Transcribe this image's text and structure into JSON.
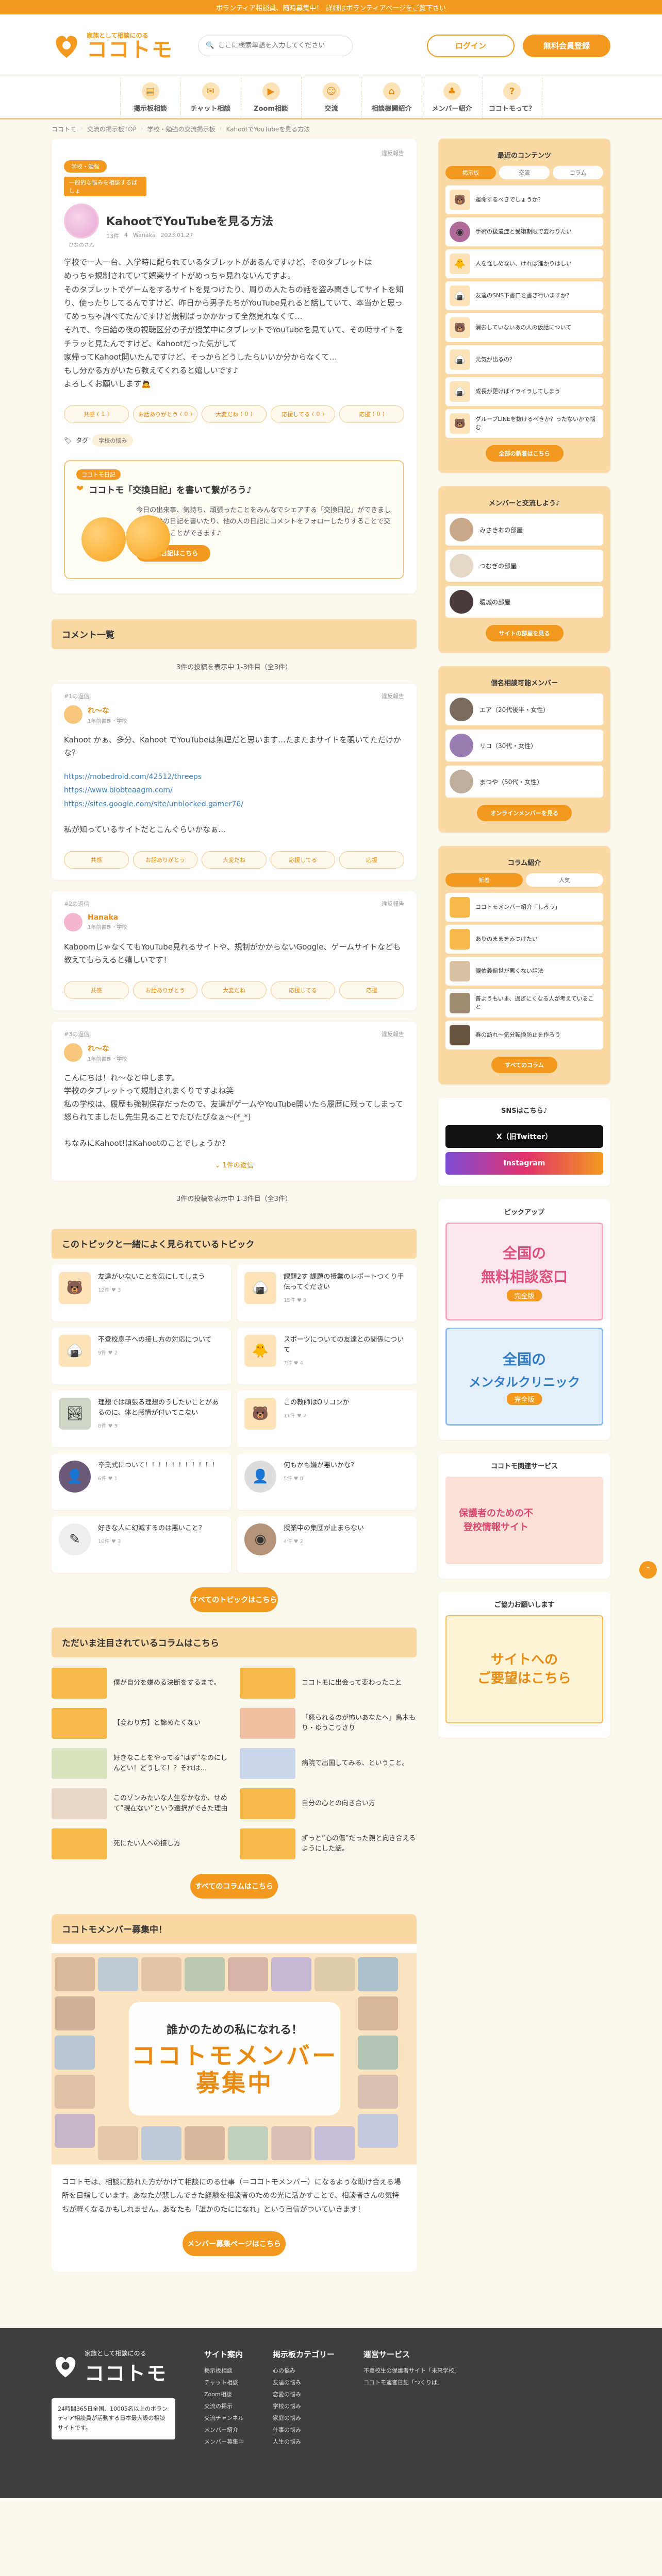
{
  "topbar": {
    "text": "ボランティア相談員、随時募集中！",
    "link": "詳細はボランティアページをご覧下さい"
  },
  "header": {
    "logo_tag": "家族として相談にのる",
    "logo_name": "ココトモ",
    "search_placeholder": "ここに検索単語を入力してください",
    "login": "ログイン",
    "register": "無料会員登録"
  },
  "gnav": [
    {
      "label": "掲示板相談",
      "icon": "board-icon"
    },
    {
      "label": "チャット相談",
      "icon": "chat-icon"
    },
    {
      "label": "Zoom相談",
      "icon": "video-icon"
    },
    {
      "label": "交流",
      "icon": "people-icon"
    },
    {
      "label": "相談機関紹介",
      "icon": "building-icon"
    },
    {
      "label": "メンバー紹介",
      "icon": "member-icon"
    },
    {
      "label": "ココトモって？",
      "icon": "info-icon"
    }
  ],
  "breadcrumb": [
    "ココトモ",
    "交流の掲示板TOP",
    "学校・勉強の交流掲示板",
    "KahootでYouTubeを見る方法"
  ],
  "post": {
    "report": "違反報告",
    "category": "学校・勉強",
    "subcategory": "一般的な悩みを相談するばしょ",
    "title": "KahootでYouTubeを見る方法",
    "meta_posts": "13件",
    "meta_likes": "4",
    "meta_author": "Wanaka",
    "date": "2023.01.27",
    "author_name": "ひなのさん",
    "body": "学校で一人一台、入学時に配られているタブレットがあるんですけど、そのタブレットは\nめっちゃ規制されていて娯楽サイトがめっちゃ見れないんですよ。\nそのタブレットでゲームをするサイトを見つけたり、周りの人たちの話を盗み聞きしてサイトを知り、使ったりしてるんですけど、昨日から男子たちがYouTube見れると話していて、本当かと思ってめっちゃ調べてたんですけど規制ばっかかかって全然見れなくて…\nそれで、今日給の夜の視聴区分の子が授業中にタブレットでYouTubeを見ていて、その時サイトをチラッと見たんですけど、Kahootだった気がして\n家帰ってKahoot開いたんですけど、そっからどうしたらいいか分からなくて…\nもし分かる方がいたら教えてくれると嬉しいです♪\nよろしくお願いします🙇",
    "reactions": [
      {
        "label": "共感",
        "count": "1"
      },
      {
        "label": "お話ありがとう",
        "count": "0"
      },
      {
        "label": "大変だね",
        "count": "0"
      },
      {
        "label": "応援してる",
        "count": "0"
      },
      {
        "label": "応援",
        "count": "0"
      }
    ],
    "tags_label": "タグ",
    "tag": "学校の悩み"
  },
  "diary": {
    "label": "ココトモ日記",
    "title": "ココトモ「交換日記」を書いて繋がろう♪",
    "text": "今日の出来事、気持ち、頑張ったことをみんなでシェアする「交換日記」ができました。自分の日記を書いたり、他の人の日記にコメントをフォローしたりすることで交流を深めることができます♪",
    "button": "交換日記はこちら"
  },
  "comments_section": {
    "title": "コメント一覧",
    "pager": "3件の投稿を表示中 1-3件目（全3件）",
    "items": [
      {
        "no": "#1の返信",
        "report": "違反報告",
        "name": "れ～な",
        "sub": "1年前書き・学校",
        "text": "Kahoot かぁ、多分、Kahoot でYouTubeは無理だと思います…たまたまサイトを覗いてただけかな？",
        "links": [
          "https://mobedroid.com/42512/threeps",
          "https://www.blobteaagm.com/",
          "https://sites.google.com/site/unblocked.gamer76/"
        ],
        "after": "私が知っているサイトだとこんぐらいかなぁ…",
        "reactions": [
          "共感",
          "お話ありがとう",
          "大変だね",
          "応援してる",
          "応援"
        ]
      },
      {
        "no": "#2の返信",
        "report": "違反報告",
        "name": "Hanaka",
        "sub": "1年前書き・学校",
        "text": "KaboomじゃなくてもYouTube見れるサイトや、規制がかからないGoogle、ゲームサイトなども教えてもらえると嬉しいです！",
        "links": [],
        "after": "",
        "reactions": [
          "共感",
          "お話ありがとう",
          "大変だね",
          "応援してる",
          "応援"
        ]
      },
      {
        "no": "#3の返信",
        "report": "違反報告",
        "name": "れ～な",
        "sub": "1年前書き・学校",
        "text": "こんにちは！れ～なと申します。\n学校のタブレットって規制されまくりですよね笑\n私の学校は、履歴も強制保存だったので、友達がゲームやYouTube開いたら履歴に残ってしまって怒られてましたし先生見ることでたびたびなぁ〜(*_*)\n\nちなみにKahoot!はKahootのことでしょうか？",
        "links": [],
        "after": "",
        "reactions": []
      }
    ],
    "more": "1件の返信"
  },
  "topics_section": {
    "title": "このトピックと一緒によく見られているトピック",
    "items": [
      {
        "title": "友達がいないことを気にしてしまう",
        "meta": "12件 ♥ 3"
      },
      {
        "title": "課題2す 課題の授業のレポートつくり手伝ってください",
        "meta": "15件 ♥ 9"
      },
      {
        "title": "不登校息子への接し方の対応について",
        "meta": "9件 ♥ 2"
      },
      {
        "title": "スポーツについての友達との関係について",
        "meta": "7件 ♥ 4"
      },
      {
        "title": "理想では頑張る理想のうしたいことがあるのに、体と感情が付いてこない",
        "meta": "8件 ♥ 5"
      },
      {
        "title": "この教師はOリコンか",
        "meta": "11件 ♥ 2"
      },
      {
        "title": "卒業式について！！！！！！！！！！！",
        "meta": "6件 ♥ 1"
      },
      {
        "title": "何もかも嫌が悪いかな？",
        "meta": "5件 ♥ 0"
      },
      {
        "title": "好きな人に幻滅するのは悪いこと？",
        "meta": "10件 ♥ 3"
      },
      {
        "title": "授業中の集団が止まらない",
        "meta": "4件 ♥ 2"
      }
    ],
    "button": "すべてのトピックはこちら"
  },
  "columns_section": {
    "title": "ただいま注目されているコラムはこちら",
    "items": [
      {
        "title": "僕が自分を嫌める決断をするまで。"
      },
      {
        "title": "ココトモに出会って変わったこと"
      },
      {
        "title": "【変わり方】と諦めたくない"
      },
      {
        "title": "「怒られるのが怖いあなたへ」鳥木もり・ゆうこりさり"
      },
      {
        "title": "好きなことをやってる”はず”なのにしんどい！どうして！？それは…"
      },
      {
        "title": "病院で出国してみる、ということ。"
      },
      {
        "title": "このゾンみたいな人生なかなか、せめて”現在ない”という選択ができた理由"
      },
      {
        "title": "自分の心との向き合い方"
      },
      {
        "title": "死にたい人への接し方"
      },
      {
        "title": "ずっと”心の傷”だった親と向き合えるようにした話。"
      }
    ],
    "button": "すべてのコラムはこちら"
  },
  "recruit": {
    "title": "ココトモメンバー募集中！",
    "banner_sub": "誰かのための私になれる！",
    "banner_main": "ココトモメンバー\n募集中",
    "text": "ココトモは、相談に訪れた方がかけて相談にのる仕事（＝ココトモメンバー）になるような助け合える場所を目指しています。あなたが悲しんできた経験を相談者のための光に活かすことで、相談者さんの気持ちが軽くなるかもしれません。あなたも「誰かのたにになれ」という自信がついていきます！",
    "button": "メンバー募集ページはこちら"
  },
  "sidebar": {
    "latest": {
      "title": "最近のコンテンツ",
      "tabs": [
        "掲示板",
        "交流",
        "コラム"
      ],
      "items": [
        "運命するべきでしょうか？",
        "手術の後遺症と受術期限で変わりたい",
        "人を怪しめない、ければ進かりはしい",
        "友達のSNS下書口を書き行いますか？",
        "消去していないあの人の仮話について",
        "元気が出るの？",
        "成長が更けばイライラしてしまう",
        "グループLINEを抜けるべきか？ったないかで悩む"
      ],
      "button": "全部の新着はこちら"
    },
    "members": {
      "title": "メンバーと交流しよう♪",
      "items": [
        "みさきおの部屋",
        "つむぎの部屋",
        "暖城の部屋"
      ],
      "button": "サイトの部屋を見る"
    },
    "online": {
      "title": "個名相談可能メンバー",
      "items": [
        "エア（20代後半・女性）",
        "リコ（30代・女性）",
        "まつや（50代・女性）"
      ],
      "button": "オンラインメンバーを見る"
    },
    "column": {
      "title": "コラム紹介",
      "tabs": [
        "新着",
        "人気"
      ],
      "items": [
        "ココトモメンバー紹介「しろう」",
        "ありのままをみつけたい",
        "親依義偏世が悪くない話法",
        "普ようもいま、過ぎにくなる人が考えていること",
        "春の訪れ〜気分転換防止を作ろう"
      ],
      "button": "すべてのコラム"
    },
    "sns": {
      "title": "SNSはこちら♪",
      "x": "X（旧Twitter）",
      "instagram": "Instagram"
    },
    "pickup": {
      "title": "ピックアップ",
      "b1a": "全国の",
      "b1b": "無料相談窓口",
      "b1c": "完全版",
      "b2a": "全国の",
      "b2b": "メンタルクリニック",
      "b2c": "完全版"
    },
    "service": {
      "title": "ココトモ関連サービス",
      "banner": "保護者のための不登校情報サイト"
    },
    "request": {
      "title": "ご協力お願いします",
      "banner": "サイトへの\nご要望はこちら"
    }
  },
  "footer": {
    "logo_tag": "家族として相談にのる",
    "logo_name": "ココトモ",
    "desc": "24時間365日全国、10005名以上のボランティア相談員が活動する日本最大級の相談サイトです。",
    "site_title": "サイト案内",
    "site": [
      "掲示板相談",
      "チャット相談",
      "Zoom相談",
      "交流の掲示",
      "交流チャンネル",
      "メンバー紹介",
      "メンバー募集中"
    ],
    "cat_title": "掲示板カテゴリー",
    "cat": [
      "心の悩み",
      "友達の悩み",
      "恋愛の悩み",
      "学校の悩み",
      "家庭の悩み",
      "仕事の悩み",
      "人生の悩み"
    ],
    "ops_title": "運営サービス",
    "ops": [
      "不登校生の保護者サイト「未来学校」",
      "ココトモ運営日記「つくりば」"
    ]
  },
  "colors": {
    "accent": "#f39a1e",
    "section": "#fbd9a4",
    "bg": "#fdf8ee"
  }
}
